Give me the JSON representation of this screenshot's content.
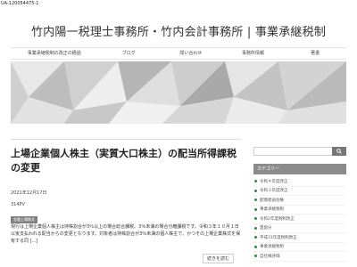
{
  "tracking_id": "UA-120054475-1",
  "site_title": "竹内陽一税理士事務所・竹内会計事務所 | 事業承継税制",
  "nav": [
    "事業承継税制の改正の経過",
    "ブログ",
    "問い合わせ",
    "事務所情報",
    "著書"
  ],
  "post": {
    "title": "上場企業個人株主（実質大口株主）の配当所得課税の変更",
    "date": "2021年12月17日",
    "views": "314PV",
    "category_badge": "金融上場株式",
    "excerpt": "現行は上場企業個人株主は持株割合が3％以上の場合総合課税、3％未満の場合分離課税です。令和３年１０月１日以後支払われる配当からの変更となります。対象者は持株割合が3％未満の個人株主で、かつその上場企業株式を保有する同 [...]",
    "readmore": "続きを読む"
  },
  "sidebar": {
    "search_placeholder": "",
    "category_heading": "カテゴリー",
    "categories": [
      "令和４年度改正",
      "令和３年度改正",
      "配偶者居住権",
      "事業承継税制",
      "令和2年度税制改正",
      "遺留分",
      "平成31年度税制改正",
      "事業承継税制",
      "自社株評価"
    ]
  },
  "colors": {
    "banner_base": "#dcdcdc",
    "sidebar_header": "#8c8c8c",
    "bullet": "#2a8c3a"
  }
}
